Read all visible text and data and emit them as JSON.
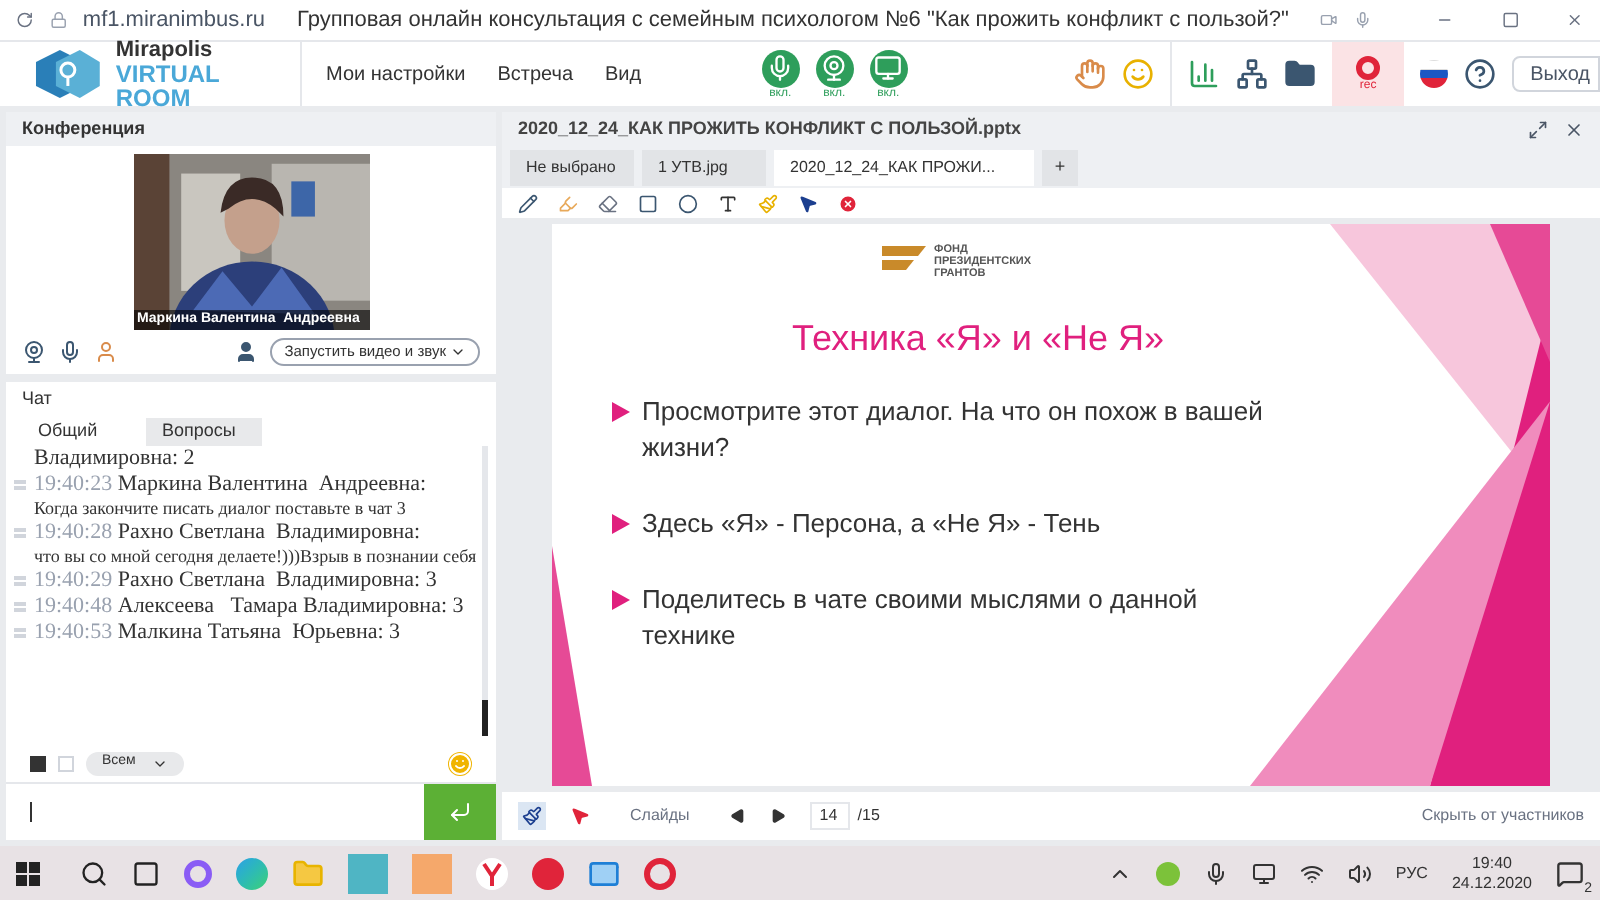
{
  "browser": {
    "url": "mf1.miranimbus.ru",
    "title": "Групповая онлайн консультация с семейным психологом №6 \"Как прожить конфликт с пользой?\""
  },
  "app": {
    "logo_line1": "Mirapolis",
    "logo_line2": "VIRTUAL ROOM",
    "menu": [
      "Мои настройки",
      "Встреча",
      "Вид"
    ],
    "media": [
      {
        "kind": "mic",
        "label": "вкл.",
        "on": true
      },
      {
        "kind": "camera",
        "label": "вкл.",
        "on": true
      },
      {
        "kind": "screen",
        "label": "вкл.",
        "on": true
      }
    ],
    "record": {
      "label": "rec",
      "on": true
    },
    "exit": "Выход"
  },
  "conference": {
    "title": "Конференция",
    "video_caption": "Маркина Валентина  Андреевна",
    "start_button": "Запустить видео и звук"
  },
  "chat": {
    "title": "Чат",
    "tabs": [
      {
        "label": "Общий",
        "selected": true
      },
      {
        "label": "Вопросы",
        "selected": false
      }
    ],
    "messages": [
      {
        "text": "Владимировна: 2"
      },
      {
        "time": "19:40:23",
        "text": "Маркина Валентина  Андреевна:",
        "body": "Когда закончите писать диалог поставьте в чат 3"
      },
      {
        "time": "19:40:28",
        "text": "Рахно Светлана  Владимировна:",
        "body": "что вы со мной сегодня делаете!)))Взрыв в познании себя"
      },
      {
        "time": "19:40:29",
        "text": "Рахно Светлана  Владимировна: 3"
      },
      {
        "time": "19:40:48",
        "text": "Алексеева   Тамара Владимировна: 3"
      },
      {
        "time": "19:40:53",
        "text": "Малкина Татьяна  Юрьевна: 3"
      }
    ],
    "audience": "Всем"
  },
  "document": {
    "title": "2020_12_24_КАК ПРОЖИТЬ КОНФЛИКТ С ПОЛЬЗОЙ.pptx",
    "tabs": [
      {
        "label": "Не выбрано",
        "selected": false
      },
      {
        "label": "1 УТВ.jpg",
        "selected": false
      },
      {
        "label": "2020_12_24_КАК ПРОЖИ...",
        "selected": true
      }
    ],
    "add_tab": "+"
  },
  "slide": {
    "logo": [
      "ФОНД",
      "ПРЕЗИДЕНТСКИХ",
      "ГРАНТОВ"
    ],
    "title": "Техника «Я» и «Не Я»",
    "bullets": [
      "Просмотрите этот диалог. На что он похож в вашей жизни?",
      "Здесь «Я» - Персона, а «Не Я» - Тень",
      "Поделитесь в чате своими мыслями о данной технике"
    ]
  },
  "slides_bar": {
    "label": "Слайды",
    "current": "14",
    "total": "/15",
    "hide": "Скрыть от участников"
  },
  "taskbar": {
    "language": "РУС",
    "time": "19:40",
    "date": "24.12.2020",
    "notifications": "2"
  }
}
